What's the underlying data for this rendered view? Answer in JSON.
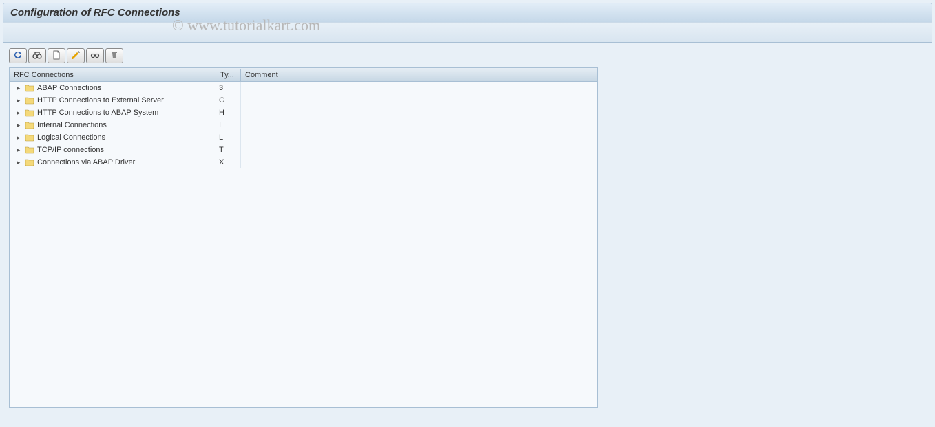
{
  "header": {
    "title": "Configuration of RFC Connections"
  },
  "watermark": "© www.tutorialkart.com",
  "toolbar": {
    "buttons": [
      {
        "name": "refresh",
        "icon": "refresh"
      },
      {
        "name": "search",
        "icon": "binoculars"
      },
      {
        "name": "create",
        "icon": "page"
      },
      {
        "name": "change",
        "icon": "pencil"
      },
      {
        "name": "display",
        "icon": "glasses"
      },
      {
        "name": "delete",
        "icon": "trash"
      }
    ]
  },
  "tree": {
    "columns": {
      "name": "RFC Connections",
      "type": "Ty...",
      "comment": "Comment"
    },
    "rows": [
      {
        "label": "ABAP Connections",
        "type": "3",
        "comment": ""
      },
      {
        "label": "HTTP Connections to External Server",
        "type": "G",
        "comment": ""
      },
      {
        "label": "HTTP Connections to ABAP System",
        "type": "H",
        "comment": ""
      },
      {
        "label": "Internal Connections",
        "type": "I",
        "comment": ""
      },
      {
        "label": "Logical Connections",
        "type": "L",
        "comment": ""
      },
      {
        "label": "TCP/IP connections",
        "type": "T",
        "comment": ""
      },
      {
        "label": "Connections via ABAP Driver",
        "type": "X",
        "comment": ""
      }
    ]
  }
}
